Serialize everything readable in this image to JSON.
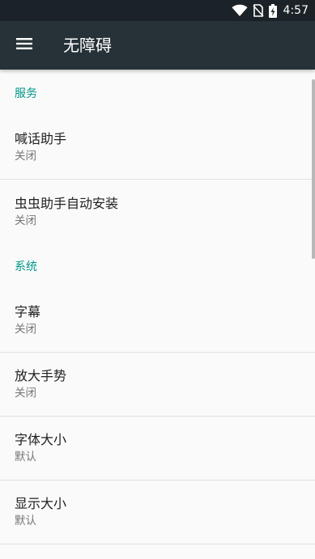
{
  "status_bar": {
    "time": "4:57",
    "icons": [
      "wifi-icon",
      "no-sim-icon",
      "battery-charging-icon"
    ]
  },
  "toolbar": {
    "menu_icon": "hamburger-menu-icon",
    "title": "无障碍"
  },
  "categories": [
    {
      "title": "服务",
      "items": [
        {
          "title": "喊话助手",
          "summary": "关闭"
        },
        {
          "title": "虫虫助手自动安装",
          "summary": "关闭"
        }
      ]
    },
    {
      "title": "系统",
      "items": [
        {
          "title": "字幕",
          "summary": "关闭"
        },
        {
          "title": "放大手势",
          "summary": "关闭"
        },
        {
          "title": "字体大小",
          "summary": "默认"
        },
        {
          "title": "显示大小",
          "summary": "默认"
        }
      ]
    }
  ],
  "colors": {
    "status_bar": "#1b2328",
    "toolbar": "#263238",
    "accent": "#009688",
    "background": "#fafafa"
  }
}
